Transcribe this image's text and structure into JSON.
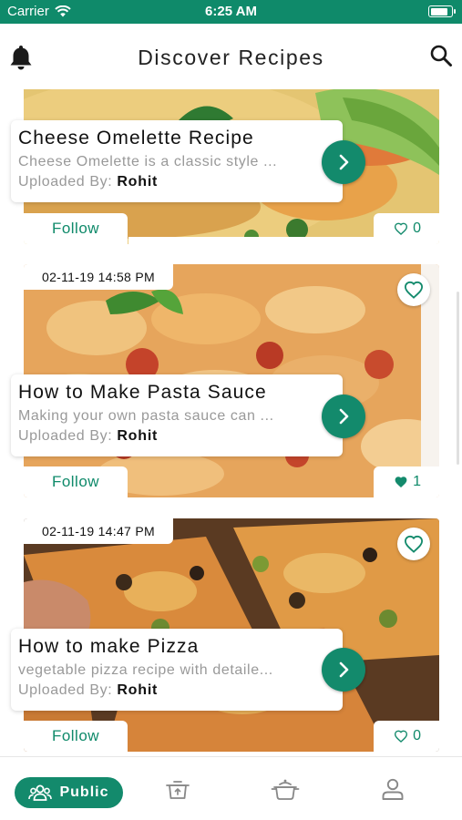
{
  "status_bar": {
    "carrier": "Carrier",
    "time": "6:25 AM",
    "battery_level": 0.9
  },
  "header": {
    "title": "Discover Recipes",
    "left_icon": "bell-icon",
    "right_icon": "search-icon"
  },
  "feed": {
    "recipes": [
      {
        "date": "",
        "title": "Cheese Omelette Recipe",
        "description": "Cheese Omelette is a classic style ...",
        "uploaded_by_label": "Uploaded By:",
        "uploader": "Rohit",
        "follow_label": "Follow",
        "like_count": "0",
        "liked": false
      },
      {
        "date": "02-11-19 14:58 PM",
        "title": "How to Make Pasta Sauce",
        "description": "Making your own pasta sauce can ...",
        "uploaded_by_label": "Uploaded By:",
        "uploader": "Rohit",
        "follow_label": "Follow",
        "like_count": "1",
        "liked": true
      },
      {
        "date": "02-11-19 14:47 PM",
        "title": "How to make Pizza",
        "description": "vegetable pizza recipe with detaile...",
        "uploaded_by_label": "Uploaded By:",
        "uploader": "Rohit",
        "follow_label": "Follow",
        "like_count": "0",
        "liked": false
      }
    ]
  },
  "tab_bar": {
    "tabs": [
      {
        "label": "Public",
        "icon": "users-icon",
        "active": true
      },
      {
        "label": "",
        "icon": "upload-pot-icon",
        "active": false
      },
      {
        "label": "",
        "icon": "cooking-pot-icon",
        "active": false
      },
      {
        "label": "",
        "icon": "profile-icon",
        "active": false
      }
    ]
  },
  "colors": {
    "accent": "#138a6c",
    "status_bar": "#0f8a6a",
    "muted_text": "#999999"
  }
}
